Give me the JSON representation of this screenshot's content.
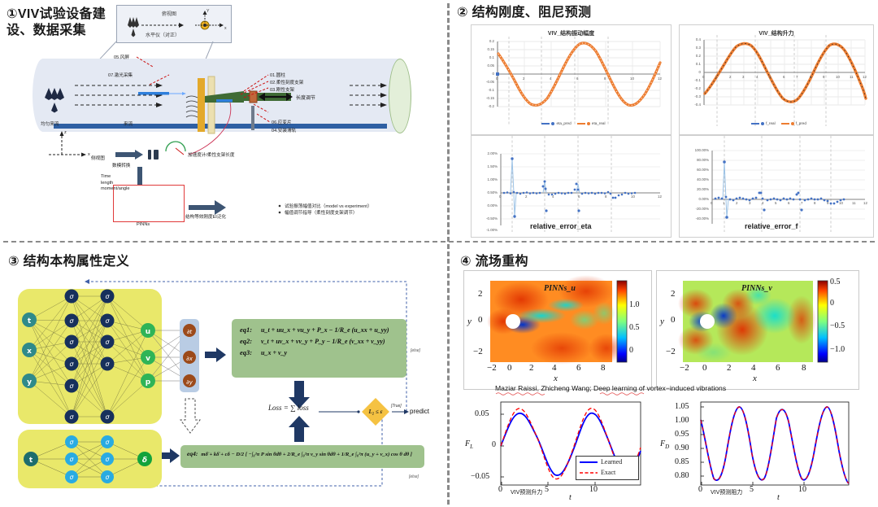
{
  "panels": {
    "p1": {
      "title": "①VIV试验设备建设、数据采集",
      "inset": {
        "top_view": "俯视图",
        "level": "水平仪（对正）",
        "axis_y": "Y",
        "axis_x": "x"
      },
      "labels": {
        "wind_screen": "05.风屏",
        "laser": "07.激光采集",
        "uniform_flow": "均匀来流",
        "come_flow": "来流",
        "side_view": "侧视图",
        "axis_z": "z",
        "axis_x": "x",
        "item01": "01.圆柱",
        "item02": "02.柔性刻度支架",
        "item03": "03.刚性支架",
        "length_adjust": "长度调节",
        "item06": "06.应变片",
        "item04": "04.安装滑轨",
        "accel": "加速度计/柔性支架长度",
        "ad_convert": "数模转换",
        "signal_list": "Time\nlength\nmoment/angle",
        "pinns": "PINNs",
        "ei_general": "结构等效刚度EI泛化",
        "bullet1": "试验振荡幅值对比（model vs experiment）",
        "bullet2": "幅值调节指导（柔性刻度支架调节）"
      }
    },
    "p2": {
      "title": "② 结构刚度、阻尼预测",
      "charts": [
        {
          "title": "VIV_结构振动幅度",
          "legend": [
            "eta_pred",
            "eta_real"
          ],
          "yticks": [
            "0.2",
            "0.15",
            "0.1",
            "0.05",
            "0",
            "-0.05",
            "-0.1",
            "-0.15",
            "-0.2"
          ],
          "xticks": [
            "0",
            "2",
            "4",
            "6",
            "8",
            "10",
            "12"
          ]
        },
        {
          "title": "VIV_结构升力",
          "legend": [
            "f_real",
            "f_pred"
          ],
          "yticks": [
            "0.4",
            "0.3",
            "0.2",
            "0.1",
            "0",
            "-0.1",
            "-0.2",
            "-0.3",
            "-0.4"
          ],
          "xticks": [
            "0",
            "1",
            "2",
            "3",
            "4",
            "5",
            "6",
            "7",
            "8",
            "9",
            "10",
            "11",
            "12"
          ]
        },
        {
          "title": "relative_error_eta",
          "yticks": [
            "2.00%",
            "1.50%",
            "1.00%",
            "0.50%",
            "0.00%",
            "-0.50%",
            "-1.00%"
          ],
          "xticks": [
            "0",
            "2",
            "4",
            "6",
            "8",
            "10",
            "12"
          ]
        },
        {
          "title": "relative_error_f",
          "yticks": [
            "100.00%",
            "80.00%",
            "60.00%",
            "40.00%",
            "20.00%",
            "0.00%",
            "-20.00%",
            "-40.00%"
          ],
          "xticks": [
            "0",
            "1",
            "2",
            "3",
            "4",
            "5",
            "6",
            "7",
            "8",
            "9",
            "10",
            "11",
            "12"
          ]
        }
      ]
    },
    "p3": {
      "title": "③ 结构本构属性定义",
      "net_top": {
        "inputs": [
          "t",
          "x",
          "y"
        ],
        "hidden_glyph": "σ",
        "outputs": [
          "u",
          "v",
          "p"
        ],
        "derivatives": [
          "∂t",
          "∂x",
          "∂y"
        ]
      },
      "net_bottom": {
        "inputs": [
          "t"
        ],
        "hidden_glyph": "σ",
        "outputs": [
          "δ"
        ]
      },
      "equations": {
        "eq1_name": "eq1:",
        "eq1": "u_t + uu_x + vu_y + P_x − 1/R_e (u_xx + u_yy)",
        "eq2_name": "eq2:",
        "eq2": "v_t + uv_x + vv_y + P_y − 1/R_e (v_xx + v_yy)",
        "eq3_name": "eq3:",
        "eq3": "u_x + v_y",
        "eq4_name": "eq4:",
        "eq4": "mδ̈ + kδ̇ + cδ − D/2 [ −∫₀²π P sin θdθ + 2/R_e ∫₀²π v_y sin θdθ + 1/R_e ∫₀²π (u_y + v_x) cos θ dθ ]"
      },
      "loss": {
        "expr": "Loss = ∑ loss",
        "criterion": "L₂ ≤ ε",
        "true_label": "[True]",
        "predict": "predict",
        "else_label_1": "[else]",
        "else_label_2": "[else]"
      }
    },
    "p4": {
      "title": "④ 流场重构",
      "field_u": {
        "title": "PINNs_u",
        "cbar_ticks": [
          "1.0",
          "0.5",
          "0"
        ],
        "xticks": [
          "−2",
          "0",
          "2",
          "4",
          "6",
          "8"
        ],
        "yticks": [
          "2",
          "0",
          "−2"
        ],
        "xlabel": "x",
        "ylabel": "y"
      },
      "field_v": {
        "title": "PINNs_v",
        "cbar_ticks": [
          "0.5",
          "0",
          "−0.5",
          "−1.0"
        ],
        "xticks": [
          "−2",
          "0",
          "2",
          "4",
          "6",
          "8"
        ],
        "yticks": [
          "2",
          "0",
          "−2"
        ],
        "xlabel": "x",
        "ylabel": "y"
      },
      "credit": "Maziar Raissi, Zhicheng Wang;  Deep learning of vortex−induced vibrations",
      "fl_plot": {
        "ylabel": "F_L",
        "xlabel": "t",
        "yticks": [
          "0.05",
          "0",
          "−0.05"
        ],
        "xticks": [
          "0",
          "5",
          "10"
        ],
        "legend": [
          "Learned",
          "Exact"
        ],
        "caption": "VIV预测升力"
      },
      "fd_plot": {
        "ylabel": "F_D",
        "xlabel": "t",
        "yticks": [
          "1.05",
          "1.00",
          "0.95",
          "0.90",
          "0.85",
          "0.80"
        ],
        "xticks": [
          "0",
          "5",
          "10"
        ],
        "caption": "VIV预测阻力"
      }
    }
  },
  "chart_data": [
    {
      "type": "line",
      "title": "VIV_结构振动幅度",
      "xlabel": "",
      "ylabel": "",
      "xlim": [
        0,
        12
      ],
      "ylim": [
        -0.2,
        0.2
      ],
      "grid": true,
      "legend_position": "bottom",
      "series": [
        {
          "name": "eta_pred",
          "color": "#4472c4",
          "x": [
            0,
            0.5,
            1,
            1.5,
            2,
            2.5,
            3,
            3.5,
            4,
            4.5,
            5,
            5.5,
            6,
            6.5,
            7,
            7.5,
            8,
            8.5,
            9,
            9.5,
            10
          ],
          "values": [
            0.125,
            0.06,
            -0.03,
            -0.12,
            -0.172,
            -0.17,
            -0.1,
            0.0,
            0.1,
            0.165,
            0.178,
            0.15,
            0.07,
            -0.04,
            -0.13,
            -0.175,
            -0.16,
            -0.09,
            0.02,
            0.12,
            0.175
          ]
        },
        {
          "name": "eta_real",
          "color": "#ed7d31",
          "x": [
            0,
            0.5,
            1,
            1.5,
            2,
            2.5,
            3,
            3.5,
            4,
            4.5,
            5,
            5.5,
            6,
            6.5,
            7,
            7.5,
            8,
            8.5,
            9,
            9.5,
            10
          ],
          "values": [
            0.125,
            0.06,
            -0.03,
            -0.12,
            -0.172,
            -0.17,
            -0.1,
            0.0,
            0.1,
            0.165,
            0.178,
            0.15,
            0.07,
            -0.04,
            -0.13,
            -0.175,
            -0.16,
            -0.09,
            0.02,
            0.12,
            0.175
          ]
        }
      ]
    },
    {
      "type": "line",
      "title": "VIV_结构升力",
      "xlim": [
        0,
        12
      ],
      "ylim": [
        -0.4,
        0.4
      ],
      "grid": true,
      "legend_position": "bottom",
      "series": [
        {
          "name": "f_real",
          "color": "#4472c4",
          "x": [
            0,
            0.5,
            1,
            1.5,
            2,
            2.5,
            3,
            3.5,
            4,
            4.5,
            5,
            5.5,
            6,
            6.5,
            7,
            7.5,
            8,
            8.5,
            9,
            9.5,
            10
          ],
          "values": [
            -0.25,
            -0.12,
            0.05,
            0.23,
            0.325,
            0.3,
            0.17,
            0.0,
            -0.18,
            -0.32,
            -0.355,
            -0.29,
            -0.13,
            0.08,
            0.26,
            0.335,
            0.3,
            0.16,
            -0.05,
            -0.25,
            -0.35
          ]
        },
        {
          "name": "f_pred",
          "color": "#ed7d31",
          "x": [
            0,
            0.5,
            1,
            1.5,
            2,
            2.5,
            3,
            3.5,
            4,
            4.5,
            5,
            5.5,
            6,
            6.5,
            7,
            7.5,
            8,
            8.5,
            9,
            9.5,
            10
          ],
          "values": [
            -0.25,
            -0.12,
            0.05,
            0.23,
            0.325,
            0.3,
            0.17,
            0.0,
            -0.18,
            -0.32,
            -0.355,
            -0.29,
            -0.13,
            0.08,
            0.26,
            0.335,
            0.3,
            0.16,
            -0.05,
            -0.25,
            -0.35
          ]
        }
      ]
    },
    {
      "type": "scatter",
      "title": "relative_error_eta",
      "xlim": [
        0,
        12
      ],
      "ylim": [
        -0.01,
        0.02
      ],
      "grid": true,
      "series": [
        {
          "name": "relative_error_eta",
          "color": "#4472c4",
          "x": [
            0.3,
            0.7,
            0.85,
            0.95,
            1.4,
            2,
            2.6,
            3.2,
            3.3,
            3.4,
            3.5,
            4,
            4.6,
            5.2,
            5.7,
            5.85,
            6,
            6.4,
            7,
            7.6,
            8.2,
            8.4,
            8.7,
            9.1,
            9.5
          ],
          "values": [
            0.0002,
            0.0005,
            0.0163,
            0.0002,
            -0.0005,
            0.0003,
            -0.0002,
            0.0035,
            0.0025,
            0.0008,
            -0.0045,
            0.0002,
            -0.0004,
            0.0004,
            0.0028,
            0.0012,
            -0.0044,
            0.0003,
            -0.0003,
            0.0004,
            -0.0002,
            -0.0018,
            -0.0012,
            -0.0005,
            0.0002
          ]
        }
      ]
    },
    {
      "type": "scatter",
      "title": "relative_error_f",
      "xlim": [
        0,
        12
      ],
      "ylim": [
        -0.4,
        1.0
      ],
      "grid": true,
      "series": [
        {
          "name": "relative_error_f",
          "color": "#4472c4",
          "x": [
            0.2,
            0.6,
            0.9,
            1.0,
            1.1,
            1.6,
            2.1,
            2.6,
            3.0,
            3.1,
            3.2,
            3.6,
            4.1,
            4.6,
            5.1,
            5.6,
            5.9,
            6.0,
            6.1,
            6.6,
            7.1,
            7.6,
            8.1,
            8.6,
            9.0,
            9.4,
            9.8
          ],
          "values": [
            0.02,
            0.03,
            0.76,
            0.05,
            -0.33,
            0.02,
            0.03,
            0.01,
            0.12,
            0.04,
            -0.19,
            0.01,
            0.02,
            0.01,
            0.0,
            0.02,
            0.11,
            0.05,
            -0.19,
            0.01,
            0.02,
            0.0,
            0.01,
            -0.04,
            -0.06,
            -0.03,
            0.02
          ]
        }
      ]
    },
    {
      "type": "line",
      "title": "VIV预测升力",
      "xlabel": "t",
      "ylabel": "F_L",
      "xlim": [
        0,
        14
      ],
      "ylim": [
        -0.07,
        0.07
      ],
      "grid": false,
      "legend_position": "bottom-right",
      "series": [
        {
          "name": "Learned",
          "color": "#0000ff",
          "x": [
            0,
            1,
            2,
            3,
            4,
            5,
            6,
            7,
            8,
            9,
            10,
            11,
            12,
            13,
            14
          ],
          "values": [
            0.025,
            0.054,
            0.035,
            -0.02,
            -0.053,
            -0.03,
            0.022,
            0.052,
            0.03,
            -0.025,
            -0.05,
            -0.02,
            0.03,
            0.047,
            0.048
          ]
        },
        {
          "name": "Exact",
          "color": "#ff0000",
          "x": [
            0,
            1,
            2,
            3,
            4,
            5,
            6,
            7,
            8,
            9,
            10,
            11,
            12,
            13,
            14
          ],
          "values": [
            0.025,
            0.058,
            0.035,
            -0.022,
            -0.06,
            -0.03,
            0.022,
            0.055,
            0.03,
            -0.027,
            -0.058,
            -0.02,
            0.03,
            0.06,
            0.048
          ]
        }
      ]
    },
    {
      "type": "line",
      "title": "VIV预测阻力",
      "xlabel": "t",
      "ylabel": "F_D",
      "xlim": [
        0,
        14
      ],
      "ylim": [
        0.76,
        1.07
      ],
      "grid": false,
      "series": [
        {
          "name": "Learned",
          "color": "#0000ff",
          "x": [
            0,
            0.7,
            1.3,
            2,
            2.6,
            3.2,
            4,
            4.5,
            5.5,
            6.2,
            7,
            7.7,
            8.6,
            9.2,
            10.2,
            11,
            11.7,
            12.5,
            13.3,
            14
          ],
          "values": [
            0.98,
            0.86,
            0.775,
            0.93,
            1.048,
            0.95,
            0.8,
            0.775,
            1.048,
            0.94,
            0.775,
            0.8,
            1.048,
            0.95,
            0.775,
            0.84,
            1.02,
            1.048,
            0.86,
            0.8
          ]
        },
        {
          "name": "Exact",
          "color": "#ff0000",
          "x": [
            0,
            0.7,
            1.3,
            2,
            2.6,
            3.2,
            4,
            4.5,
            5.5,
            6.2,
            7,
            7.7,
            8.6,
            9.2,
            10.2,
            11,
            11.7,
            12.5,
            13.3,
            14
          ],
          "values": [
            0.98,
            0.86,
            0.775,
            0.93,
            1.048,
            0.95,
            0.8,
            0.775,
            1.048,
            0.94,
            0.775,
            0.8,
            1.048,
            0.95,
            0.775,
            0.84,
            1.02,
            1.048,
            0.86,
            0.8
          ]
        }
      ]
    }
  ]
}
